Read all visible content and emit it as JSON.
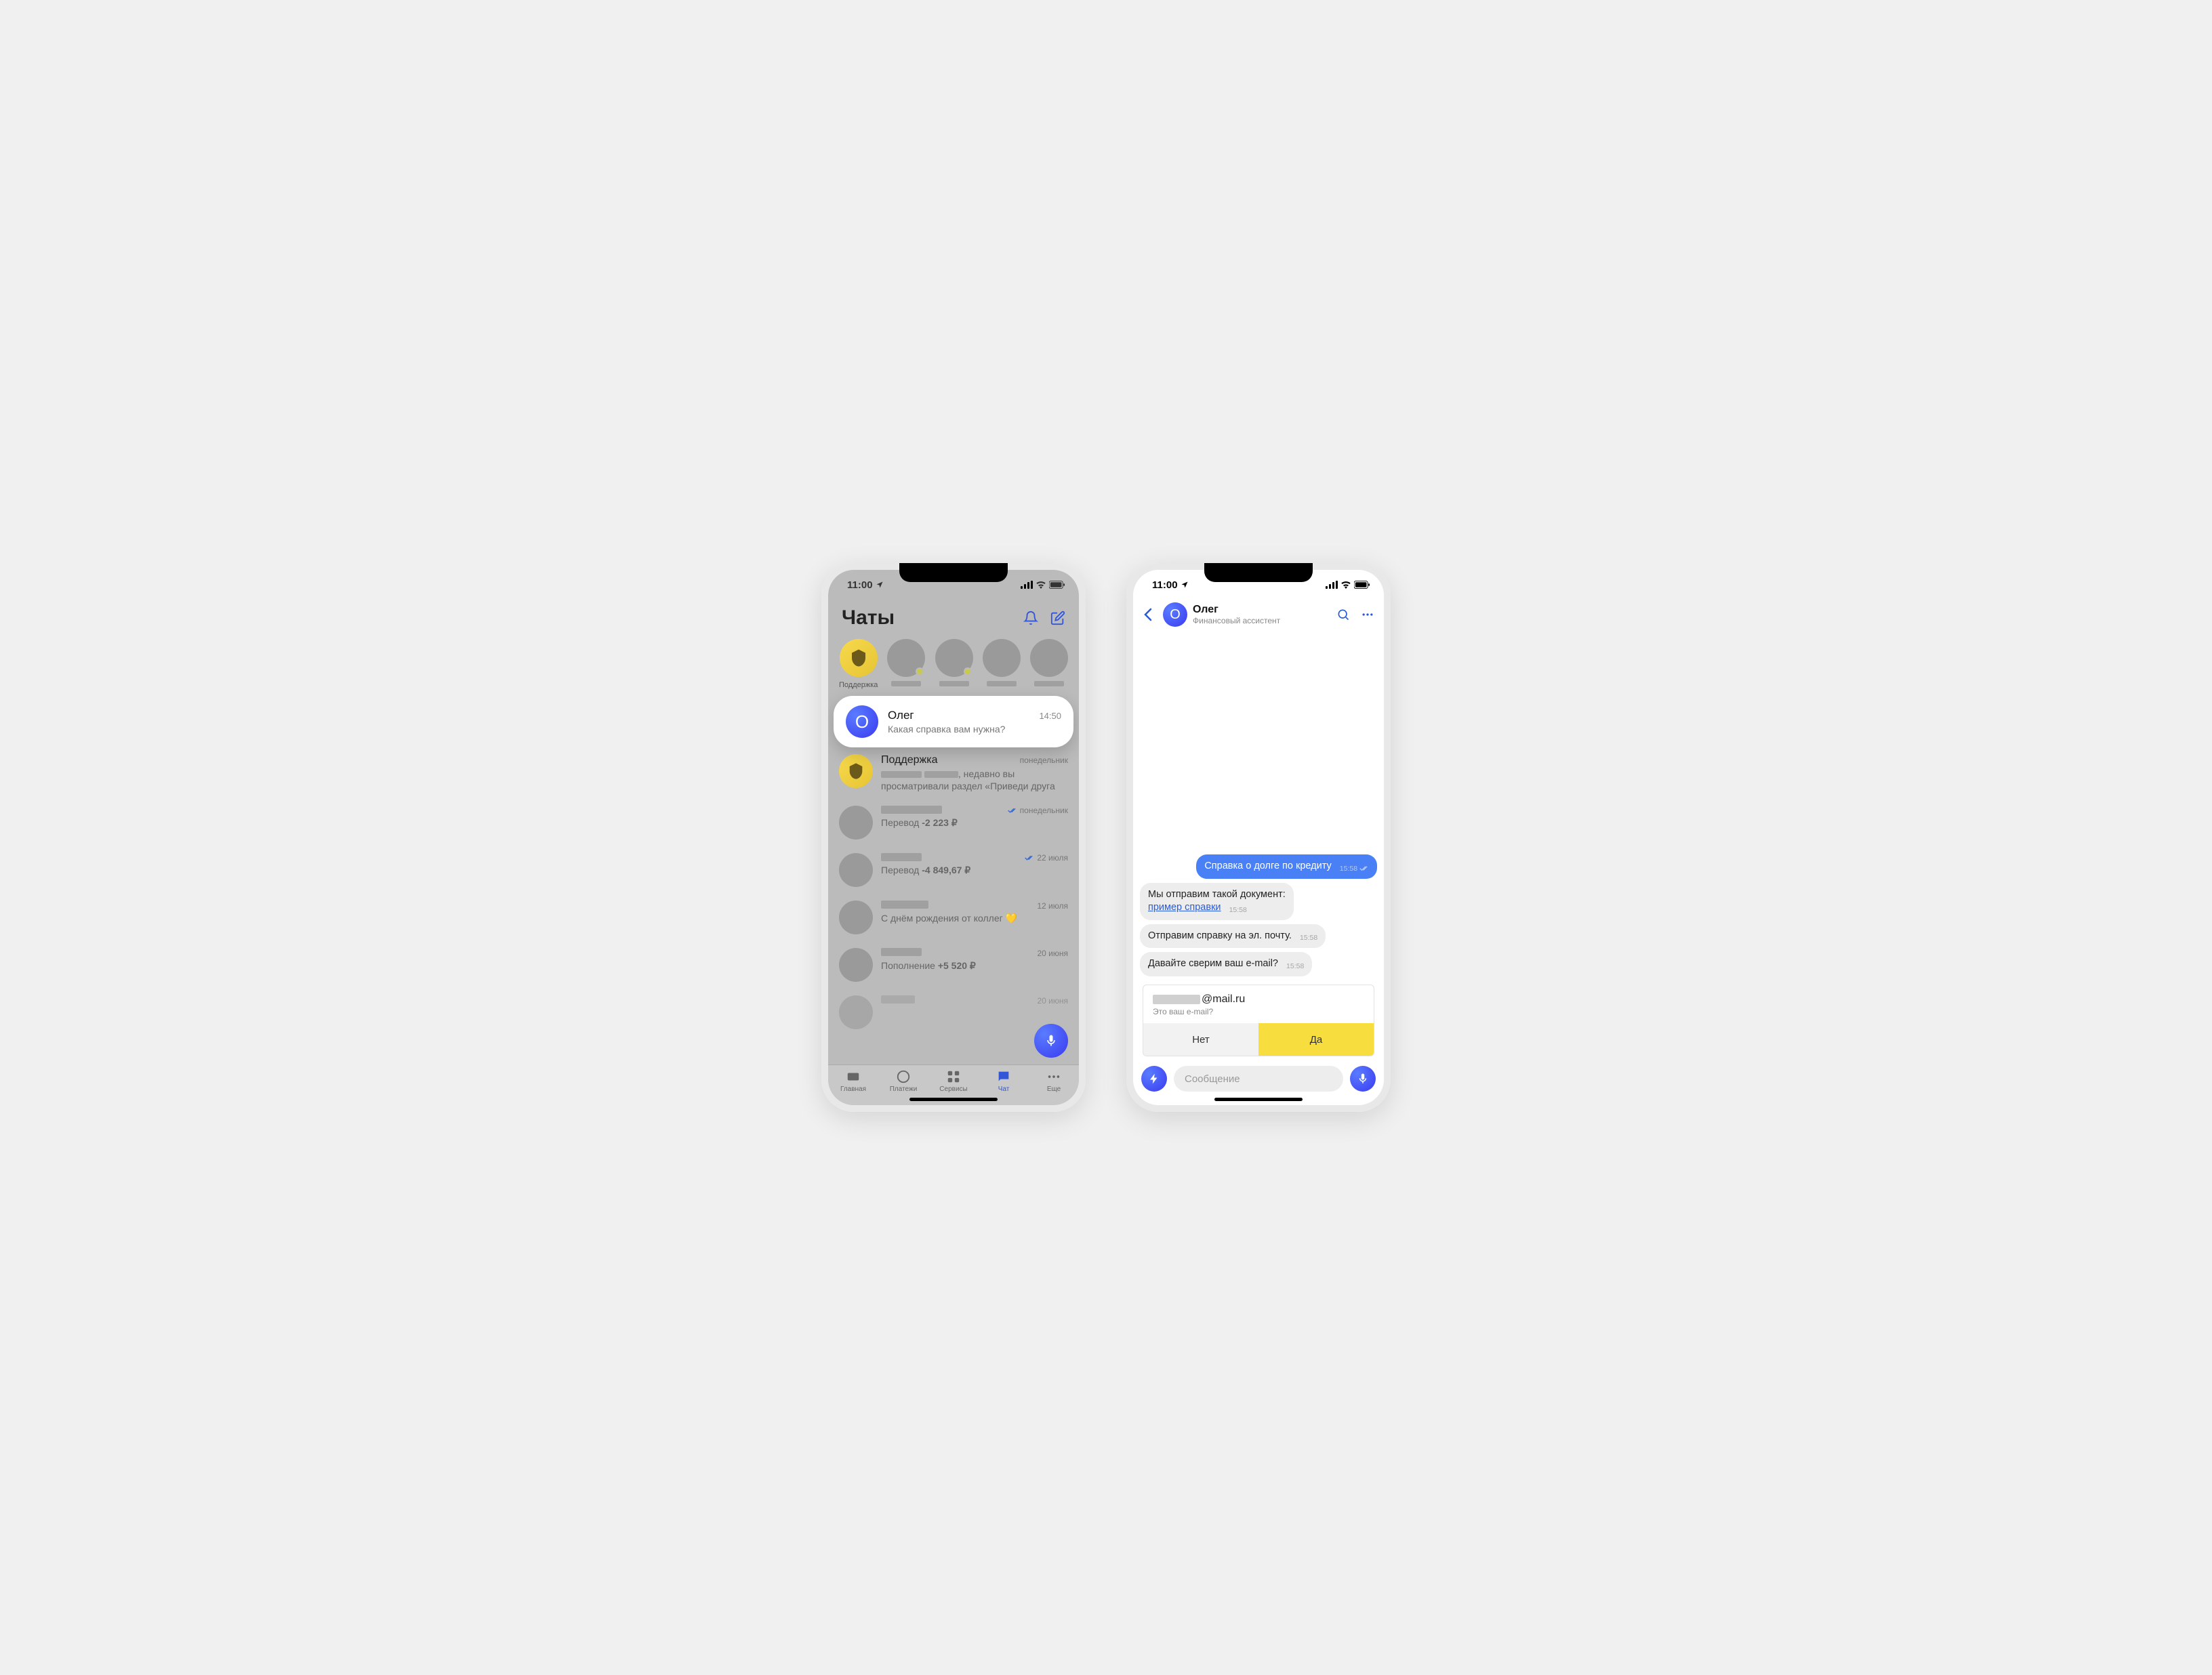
{
  "status": {
    "time": "11:00"
  },
  "phone1": {
    "header": {
      "title": "Чаты"
    },
    "stories": [
      {
        "label": "Поддержка"
      }
    ],
    "highlight": {
      "avatar_letter": "О",
      "name": "Олег",
      "preview": "Какая справка вам нужна?",
      "time": "14:50"
    },
    "rows": {
      "support": {
        "name": "Поддержка",
        "preview_suffix": ", недавно вы просматривали раздел «Приведи друга",
        "time": "понедельник"
      },
      "r1": {
        "preview_prefix": "Перевод ",
        "amount": "-2 223 ₽",
        "time": "понедельник"
      },
      "r2": {
        "preview_prefix": "Перевод ",
        "amount": "-4 849,67 ₽",
        "time": "22 июля"
      },
      "r3": {
        "preview": "С днём рождения от коллег 💛",
        "time": "12 июля"
      },
      "r4": {
        "preview_prefix": "Пополнение ",
        "amount": "+5 520 ₽",
        "time": "20 июня"
      },
      "r5": {
        "time": "20 июня"
      }
    },
    "tabs": {
      "home": "Главная",
      "payments": "Платежи",
      "services": "Сервисы",
      "chat": "Чат",
      "more": "Еще"
    }
  },
  "phone2": {
    "header": {
      "avatar_letter": "О",
      "title": "Олег",
      "subtitle": "Финансовый ассистент"
    },
    "messages": {
      "out1": {
        "text": "Справка о долге по кредиту",
        "time": "15:58"
      },
      "in1": {
        "text": "Мы отправим такой документ:",
        "link": "пример справки",
        "time": "15:58"
      },
      "in2": {
        "text": "Отправим справку на эл. почту.",
        "time": "15:58"
      },
      "in3": {
        "text": "Давайте сверим ваш e-mail?",
        "time": "15:58"
      }
    },
    "email_card": {
      "domain": "@mail.ru",
      "question": "Это ваш e-mail?",
      "no": "Нет",
      "yes": "Да"
    },
    "input": {
      "placeholder": "Сообщение"
    }
  }
}
